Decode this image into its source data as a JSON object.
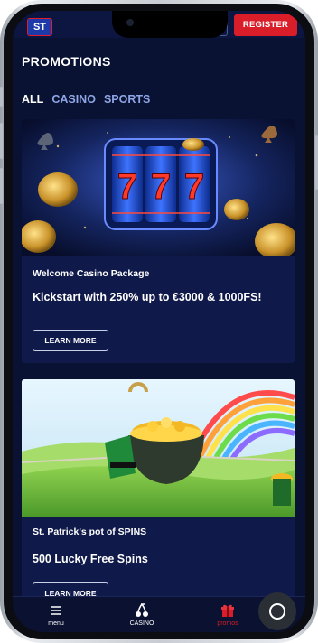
{
  "header": {
    "logo_text": "ST",
    "register_label": "REGISTER"
  },
  "page": {
    "title": "PROMOTIONS"
  },
  "tabs": [
    {
      "label": "ALL",
      "active": true
    },
    {
      "label": "CASINO",
      "active": false
    },
    {
      "label": "SPORTS",
      "active": false
    }
  ],
  "promotions": [
    {
      "subtitle": "Welcome Casino Package",
      "headline": "Kickstart with 250% up to €3000 & 1000FS!",
      "button_label": "LEARN MORE",
      "image_icon": "slot-machine-777-icon",
      "reel_symbols": [
        "7",
        "7",
        "7"
      ]
    },
    {
      "subtitle": "St. Patrick's pot of SPINS",
      "headline": "500 Lucky Free Spins",
      "button_label": "LEARN MORE",
      "image_icon": "pot-of-gold-rainbow-icon"
    }
  ],
  "bottom_nav": [
    {
      "label": "menu",
      "icon": "hamburger-icon"
    },
    {
      "label": "CASINO",
      "icon": "cherries-icon"
    },
    {
      "label": "promos",
      "icon": "gift-icon"
    }
  ],
  "colors": {
    "background": "#0a1233",
    "card": "#101a4a",
    "accent_red": "#d91e2a",
    "tab_inactive": "#8ea6e6"
  }
}
